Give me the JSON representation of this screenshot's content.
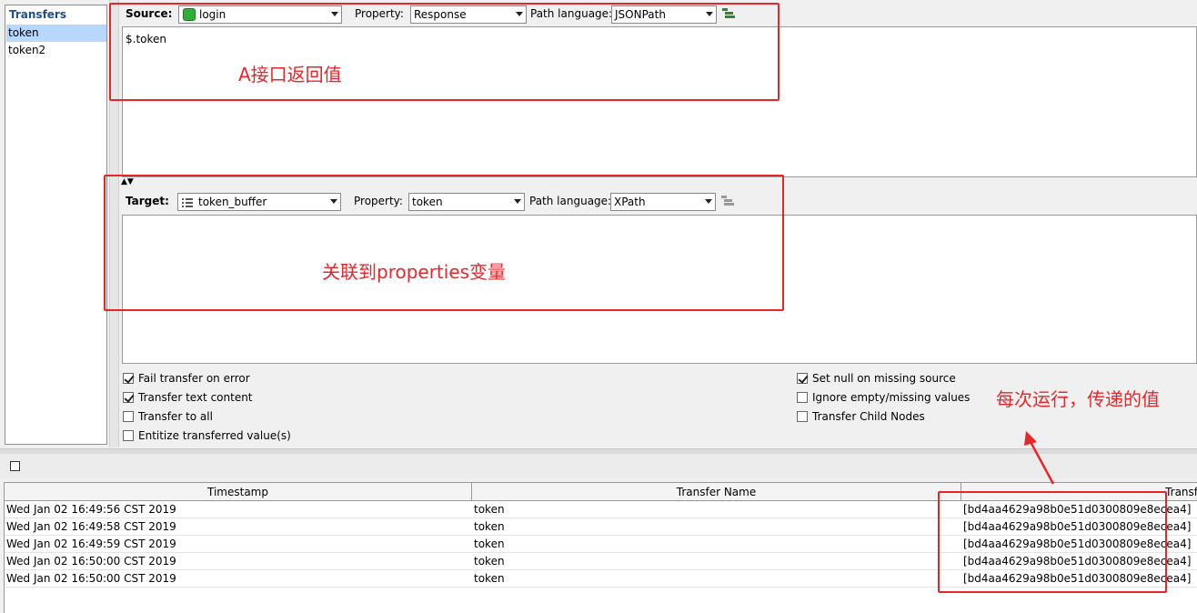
{
  "transfers": {
    "title": "Transfers",
    "items": [
      {
        "label": "token",
        "selected": true
      },
      {
        "label": "token2",
        "selected": false
      }
    ]
  },
  "source": {
    "label": "Source:",
    "step": "login",
    "step_icon": "soap-step-icon",
    "property_label": "Property:",
    "property": "Response",
    "path_language_label": "Path language:",
    "path_language": "JSONPath",
    "expression": "$.token"
  },
  "target": {
    "label": "Target:",
    "step": "token_buffer",
    "step_icon": "properties-icon",
    "property_label": "Property:",
    "property": "token",
    "path_language_label": "Path language:",
    "path_language": "XPath",
    "expression": ""
  },
  "options": {
    "fail_transfer_on_error": {
      "label": "Fail transfer on error",
      "checked": true
    },
    "transfer_text_content": {
      "label": "Transfer text content",
      "checked": true
    },
    "transfer_to_all": {
      "label": "Transfer to all",
      "checked": false
    },
    "entitize": {
      "label": "Entitize transferred value(s)",
      "checked": false
    },
    "set_null": {
      "label": "Set null on missing source",
      "checked": true
    },
    "ignore_empty": {
      "label": "Ignore empty/missing values",
      "checked": false
    },
    "transfer_child_nodes": {
      "label": "Transfer Child Nodes",
      "checked": false
    }
  },
  "log": {
    "columns": [
      "Timestamp",
      "Transfer Name",
      "Transf"
    ],
    "rows": [
      [
        "Wed Jan 02 16:49:56 CST 2019",
        "token",
        "[bd4aa4629a98b0e51d0300809e8ecea4]"
      ],
      [
        "Wed Jan 02 16:49:58 CST 2019",
        "token",
        "[bd4aa4629a98b0e51d0300809e8ecea4]"
      ],
      [
        "Wed Jan 02 16:49:59 CST 2019",
        "token",
        "[bd4aa4629a98b0e51d0300809e8ecea4]"
      ],
      [
        "Wed Jan 02 16:50:00 CST 2019",
        "token",
        "[bd4aa4629a98b0e51d0300809e8ecea4]"
      ],
      [
        "Wed Jan 02 16:50:00 CST 2019",
        "token",
        "[bd4aa4629a98b0e51d0300809e8ecea4]"
      ]
    ]
  },
  "annotations": {
    "source_note": "A接口返回值",
    "target_note": "关联到properties变量",
    "value_note": "每次运行，传递的值",
    "color": "#e8262a"
  }
}
